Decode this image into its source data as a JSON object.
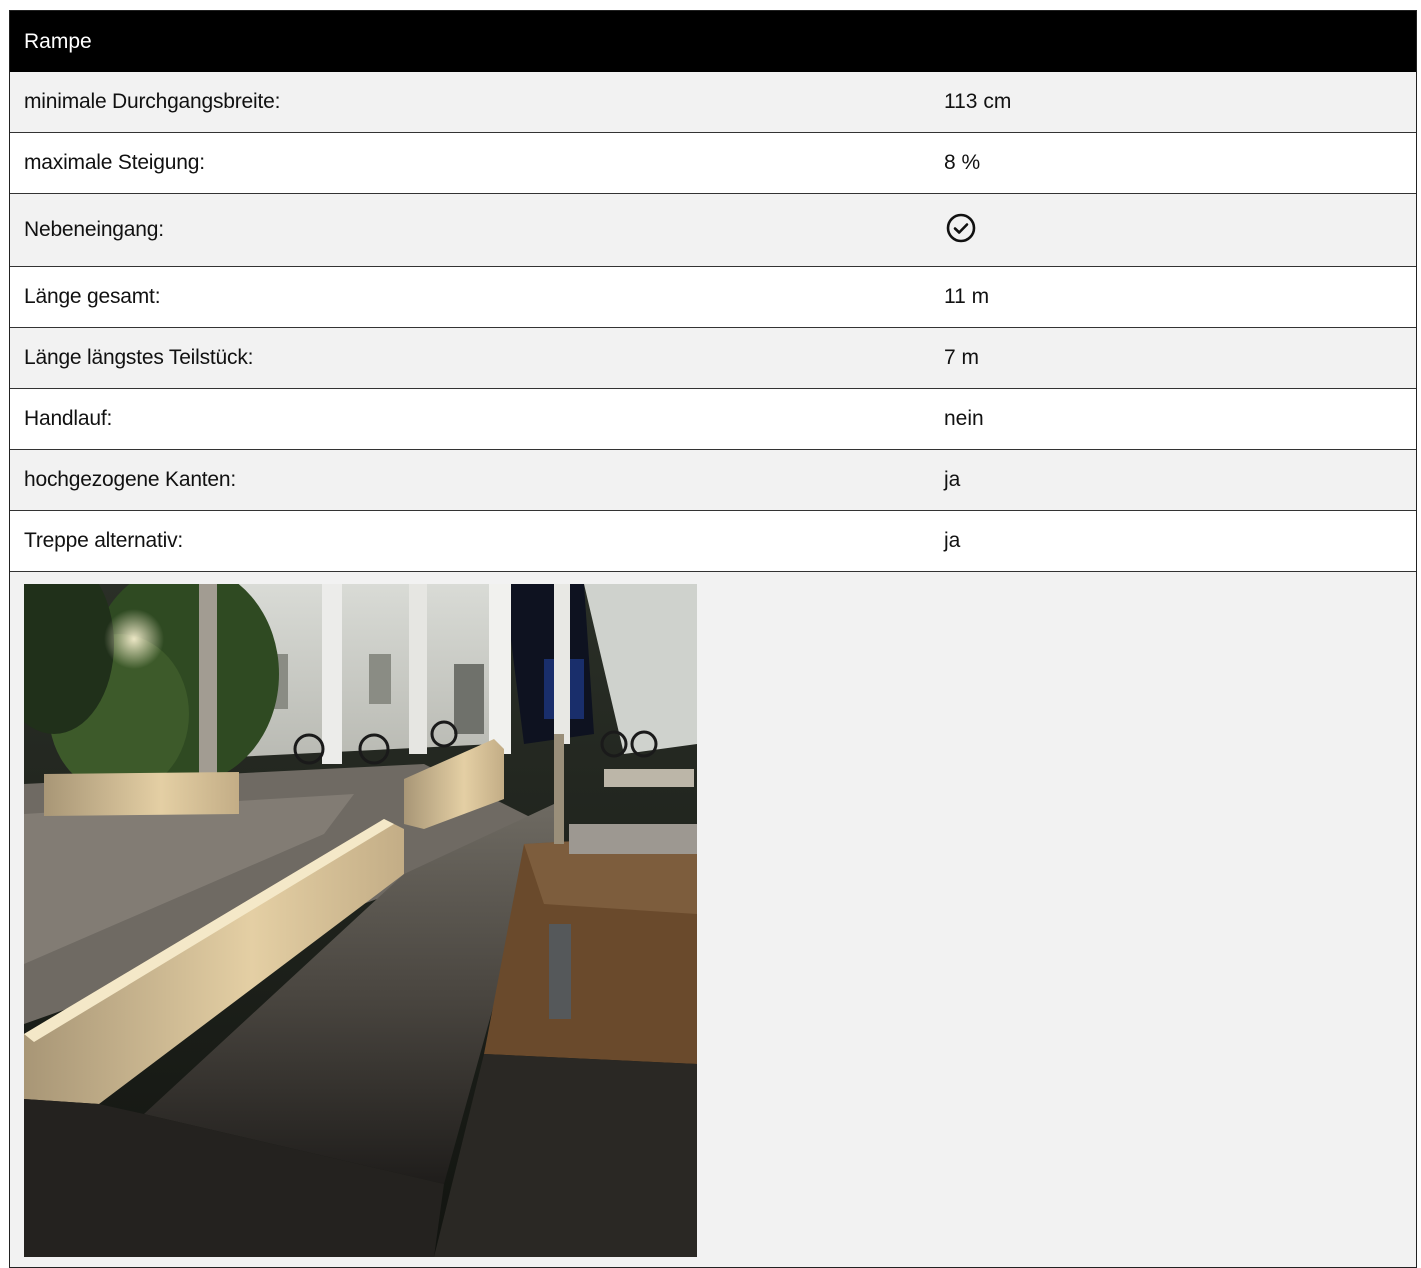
{
  "section": {
    "title": "Rampe"
  },
  "rows": [
    {
      "label": "minimale Durchgangsbreite:",
      "value": "113 cm"
    },
    {
      "label": "maximale Steigung:",
      "value": "8 %"
    },
    {
      "label": "Nebeneingang:",
      "value": "",
      "icon": "check-circle-icon"
    },
    {
      "label": "Länge gesamt:",
      "value": "11 m"
    },
    {
      "label": "Länge längstes Teilstück:",
      "value": "7 m"
    },
    {
      "label": "Handlauf:",
      "value": "nein"
    },
    {
      "label": "hochgezogene Kanten:",
      "value": "ja"
    },
    {
      "label": "Treppe alternativ:",
      "value": "ja"
    }
  ],
  "colors": {
    "header_bg": "#000000",
    "alt_row_bg": "#f2f2f2"
  }
}
